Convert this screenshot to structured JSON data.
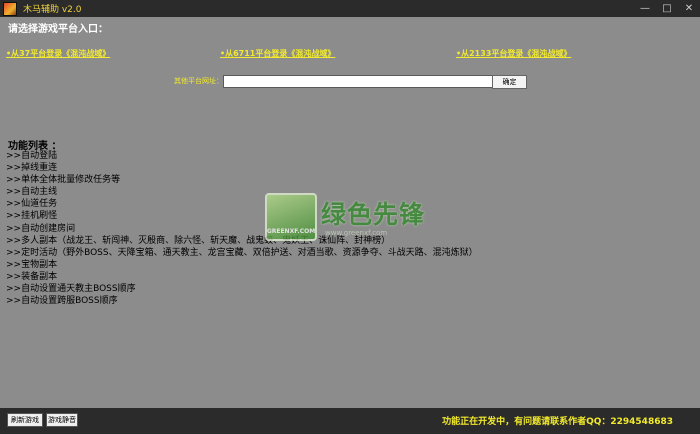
{
  "window": {
    "title": "木马辅助 v2.0",
    "controls": [
      "—",
      "□",
      "✕"
    ]
  },
  "heading": "请选择游戏平台入口：",
  "entry_links": [
    "•从37平台登录《混沌战域》",
    "•从6711平台登录《混沌战域》",
    "•从2133平台登录《混沌战域》"
  ],
  "other_platform": {
    "label": "其他平台网址：",
    "value": "",
    "confirm_label": "确定"
  },
  "features": {
    "title": "功能列表 ：",
    "items": [
      ">>自动登陆",
      ">>掉线重连",
      ">>单体全体批量修改任务等",
      ">>自动主线",
      ">>仙道任务",
      ">>挂机刷怪",
      ">>自动创建房间",
      ">>多人副本（战龙王、斩闯神、灭殷商、除六怪、斩天魔、战鬼蛟、鬼妖王、诛仙阵、封神榜）",
      ">>定时活动（野外BOSS、天降宝箱、通天教主、龙宫宝藏、双倍护送、对酒当歌、资源争夺、斗战天路、混沌炼狱）",
      ">>宝物副本",
      ">>装备副本",
      ">>自动设置通天教主BOSS顺序",
      ">>自动设置跨服BOSS顺序"
    ]
  },
  "watermark": {
    "logo_text": "GREENXF.COM",
    "cn_text": "绿色先锋",
    "url": "www.greenxf.com"
  },
  "bottom": {
    "refresh_label": "刷新游戏",
    "close_label": "游戏静音",
    "status": "功能正在开发中，有问题请联系作者QQ：2294548683"
  },
  "colors": {
    "background": "#8c8c8c",
    "bar": "#2b2b2b",
    "accent_yellow": "#f2ea2c"
  }
}
